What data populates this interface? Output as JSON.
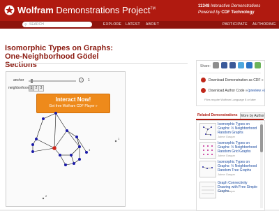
{
  "header": {
    "brand_bold": "Wolfram",
    "brand_rest": "Demonstrations Project",
    "tm": "TM",
    "count": "11348",
    "tagline_rest": "Interactive Demonstrations",
    "powered": "Powered by",
    "cdf": "CDF Technology"
  },
  "nav": {
    "search_placeholder": "SEARCH",
    "left": [
      "EXPLORE",
      "LATEST",
      "ABOUT"
    ],
    "right": [
      "PARTICIPATE",
      "AUTHORING"
    ]
  },
  "title": "Isomorphic Types on Graphs: One-Neighborhood Gödel Sections",
  "controls": {
    "anchor_label": "anchor",
    "anchor_value": "1",
    "anchor_level": 0.05,
    "neighborhood_label": "neighborhood",
    "neighborhood_options": [
      "1",
      "2",
      "3"
    ]
  },
  "cdf_button": {
    "main": "Interact Now!",
    "sub": "Get free Wolfram CDF Player »"
  },
  "graph_labels": [
    "1",
    "2",
    "3"
  ],
  "sidebar": {
    "share_label": "Share:",
    "download_demo": "Download Demonstration as CDF »",
    "download_code": "Download Author Code »",
    "code_version": "(preview »)",
    "note": "Files require Wolfram Language 8 or later",
    "tab_related": "Related Demonstrations",
    "tab_more": "More by Author",
    "related": [
      {
        "title": "Isomorphic Types on Graphs: ½ Neighborhood Random Graphs",
        "author": "Jaime Gaspar"
      },
      {
        "title": "Isomorphic Types on Graphs: ½ Neighborhood Random Grid Graphs",
        "author": "Jaime Gaspar"
      },
      {
        "title": "Isomorphic Types on Graphs: ½ Neighborhood Random Tree Graphs",
        "author": "Jaime Gaspar"
      },
      {
        "title": "Graph Connectivity Drawing with Free Simple Graphs",
        "author": "Jaime Gaspar"
      }
    ]
  },
  "colors": {
    "header_red": "#b01a10",
    "nav_red": "#8e140d",
    "title_red": "#8b1a10",
    "cdf_orange": "#ee8a1b",
    "node_blue": "#1a1aa8",
    "node_red": "#d0251a"
  }
}
